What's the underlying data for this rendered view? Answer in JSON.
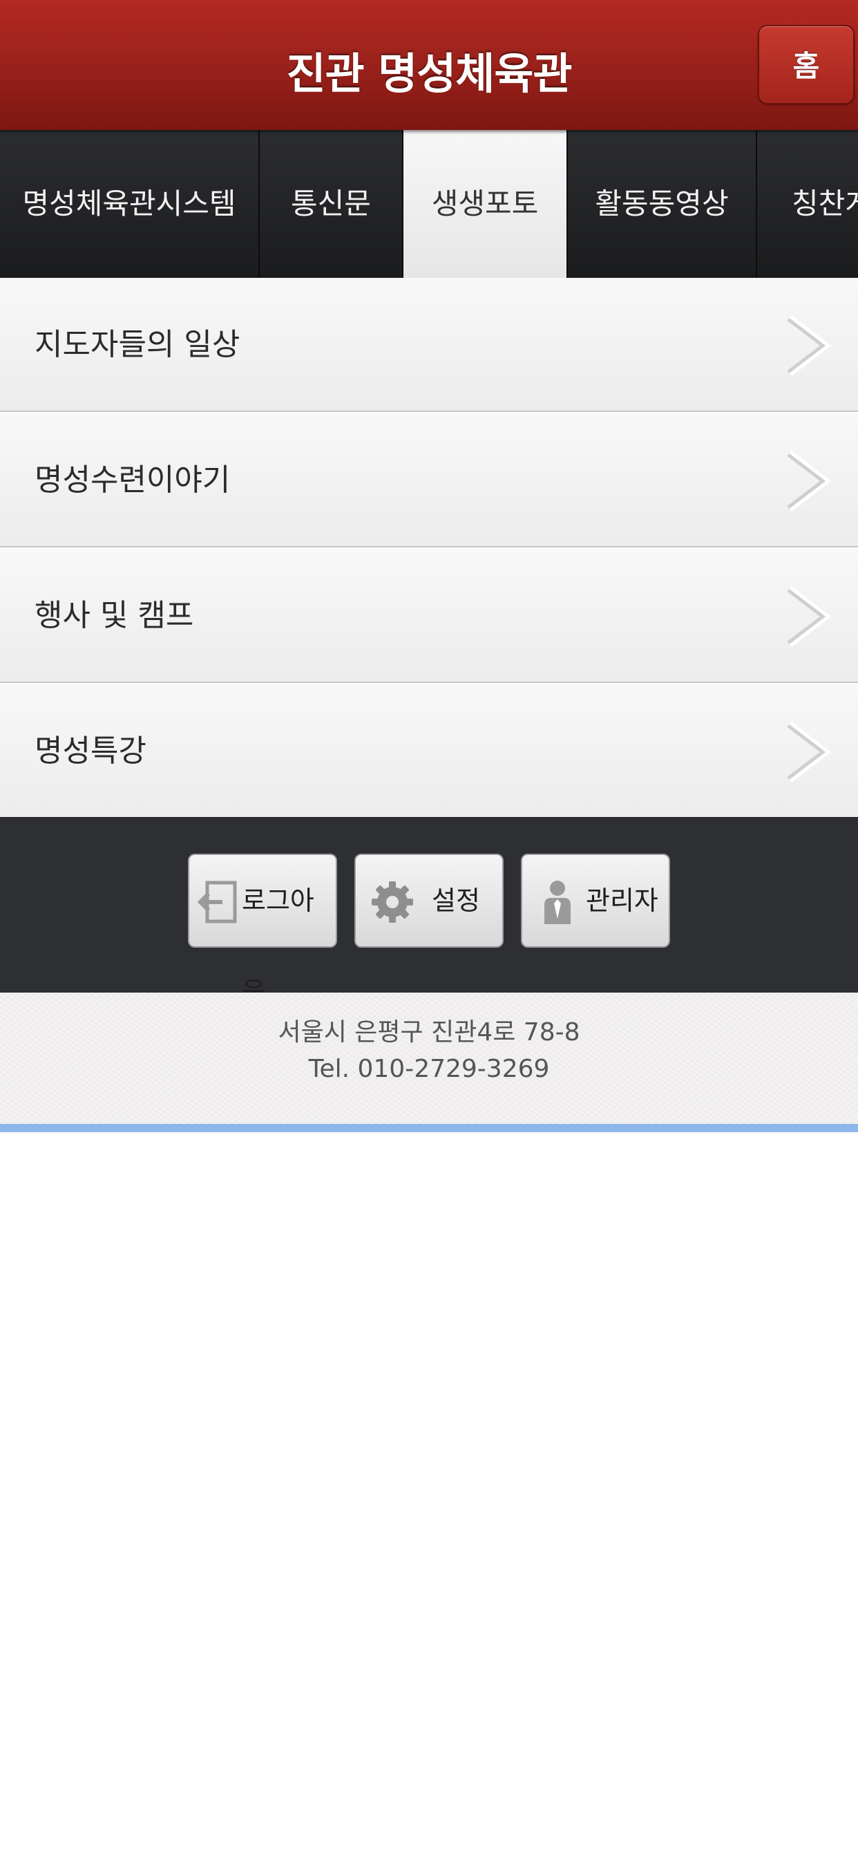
{
  "header": {
    "title": "진관 명성체육관",
    "home_label": "홈",
    "bar_color": "#98201a"
  },
  "tabs": [
    {
      "label": "명성체육관시스템",
      "active": false
    },
    {
      "label": "통신문",
      "active": false
    },
    {
      "label": "생생포토",
      "active": true
    },
    {
      "label": "활동동영상",
      "active": false
    },
    {
      "label": "칭찬게",
      "active": false
    }
  ],
  "menu": {
    "items": [
      {
        "label": "지도자들의 일상"
      },
      {
        "label": "명성수련이야기"
      },
      {
        "label": "행사 및 캠프"
      },
      {
        "label": "명성특강"
      }
    ],
    "chevron_icon": "chevron-right-icon"
  },
  "toolbar": {
    "logout": {
      "label": "로그아웃",
      "icon": "logout-icon"
    },
    "settings": {
      "label": "설정",
      "icon": "gear-icon"
    },
    "admin": {
      "label": "관리자",
      "icon": "admin-person-icon"
    }
  },
  "footer": {
    "address": "서울시 은평구 진관4로 78-8",
    "phone": "Tel. 010-2729-3269",
    "accent_color": "#8db7e8"
  }
}
